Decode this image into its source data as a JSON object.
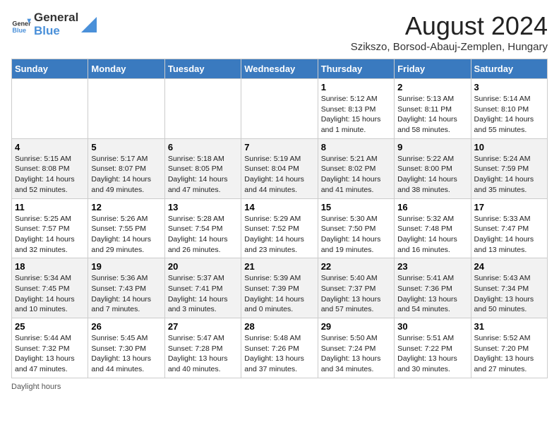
{
  "header": {
    "logo_general": "General",
    "logo_blue": "Blue",
    "month_title": "August 2024",
    "subtitle": "Szikszo, Borsod-Abauj-Zemplen, Hungary"
  },
  "days_of_week": [
    "Sunday",
    "Monday",
    "Tuesday",
    "Wednesday",
    "Thursday",
    "Friday",
    "Saturday"
  ],
  "weeks": [
    [
      {
        "day": "",
        "info": ""
      },
      {
        "day": "",
        "info": ""
      },
      {
        "day": "",
        "info": ""
      },
      {
        "day": "",
        "info": ""
      },
      {
        "day": "1",
        "info": "Sunrise: 5:12 AM\nSunset: 8:13 PM\nDaylight: 15 hours and 1 minute."
      },
      {
        "day": "2",
        "info": "Sunrise: 5:13 AM\nSunset: 8:11 PM\nDaylight: 14 hours and 58 minutes."
      },
      {
        "day": "3",
        "info": "Sunrise: 5:14 AM\nSunset: 8:10 PM\nDaylight: 14 hours and 55 minutes."
      }
    ],
    [
      {
        "day": "4",
        "info": "Sunrise: 5:15 AM\nSunset: 8:08 PM\nDaylight: 14 hours and 52 minutes."
      },
      {
        "day": "5",
        "info": "Sunrise: 5:17 AM\nSunset: 8:07 PM\nDaylight: 14 hours and 49 minutes."
      },
      {
        "day": "6",
        "info": "Sunrise: 5:18 AM\nSunset: 8:05 PM\nDaylight: 14 hours and 47 minutes."
      },
      {
        "day": "7",
        "info": "Sunrise: 5:19 AM\nSunset: 8:04 PM\nDaylight: 14 hours and 44 minutes."
      },
      {
        "day": "8",
        "info": "Sunrise: 5:21 AM\nSunset: 8:02 PM\nDaylight: 14 hours and 41 minutes."
      },
      {
        "day": "9",
        "info": "Sunrise: 5:22 AM\nSunset: 8:00 PM\nDaylight: 14 hours and 38 minutes."
      },
      {
        "day": "10",
        "info": "Sunrise: 5:24 AM\nSunset: 7:59 PM\nDaylight: 14 hours and 35 minutes."
      }
    ],
    [
      {
        "day": "11",
        "info": "Sunrise: 5:25 AM\nSunset: 7:57 PM\nDaylight: 14 hours and 32 minutes."
      },
      {
        "day": "12",
        "info": "Sunrise: 5:26 AM\nSunset: 7:55 PM\nDaylight: 14 hours and 29 minutes."
      },
      {
        "day": "13",
        "info": "Sunrise: 5:28 AM\nSunset: 7:54 PM\nDaylight: 14 hours and 26 minutes."
      },
      {
        "day": "14",
        "info": "Sunrise: 5:29 AM\nSunset: 7:52 PM\nDaylight: 14 hours and 23 minutes."
      },
      {
        "day": "15",
        "info": "Sunrise: 5:30 AM\nSunset: 7:50 PM\nDaylight: 14 hours and 19 minutes."
      },
      {
        "day": "16",
        "info": "Sunrise: 5:32 AM\nSunset: 7:48 PM\nDaylight: 14 hours and 16 minutes."
      },
      {
        "day": "17",
        "info": "Sunrise: 5:33 AM\nSunset: 7:47 PM\nDaylight: 14 hours and 13 minutes."
      }
    ],
    [
      {
        "day": "18",
        "info": "Sunrise: 5:34 AM\nSunset: 7:45 PM\nDaylight: 14 hours and 10 minutes."
      },
      {
        "day": "19",
        "info": "Sunrise: 5:36 AM\nSunset: 7:43 PM\nDaylight: 14 hours and 7 minutes."
      },
      {
        "day": "20",
        "info": "Sunrise: 5:37 AM\nSunset: 7:41 PM\nDaylight: 14 hours and 3 minutes."
      },
      {
        "day": "21",
        "info": "Sunrise: 5:39 AM\nSunset: 7:39 PM\nDaylight: 14 hours and 0 minutes."
      },
      {
        "day": "22",
        "info": "Sunrise: 5:40 AM\nSunset: 7:37 PM\nDaylight: 13 hours and 57 minutes."
      },
      {
        "day": "23",
        "info": "Sunrise: 5:41 AM\nSunset: 7:36 PM\nDaylight: 13 hours and 54 minutes."
      },
      {
        "day": "24",
        "info": "Sunrise: 5:43 AM\nSunset: 7:34 PM\nDaylight: 13 hours and 50 minutes."
      }
    ],
    [
      {
        "day": "25",
        "info": "Sunrise: 5:44 AM\nSunset: 7:32 PM\nDaylight: 13 hours and 47 minutes."
      },
      {
        "day": "26",
        "info": "Sunrise: 5:45 AM\nSunset: 7:30 PM\nDaylight: 13 hours and 44 minutes."
      },
      {
        "day": "27",
        "info": "Sunrise: 5:47 AM\nSunset: 7:28 PM\nDaylight: 13 hours and 40 minutes."
      },
      {
        "day": "28",
        "info": "Sunrise: 5:48 AM\nSunset: 7:26 PM\nDaylight: 13 hours and 37 minutes."
      },
      {
        "day": "29",
        "info": "Sunrise: 5:50 AM\nSunset: 7:24 PM\nDaylight: 13 hours and 34 minutes."
      },
      {
        "day": "30",
        "info": "Sunrise: 5:51 AM\nSunset: 7:22 PM\nDaylight: 13 hours and 30 minutes."
      },
      {
        "day": "31",
        "info": "Sunrise: 5:52 AM\nSunset: 7:20 PM\nDaylight: 13 hours and 27 minutes."
      }
    ]
  ],
  "footer": {
    "note": "Daylight hours"
  }
}
